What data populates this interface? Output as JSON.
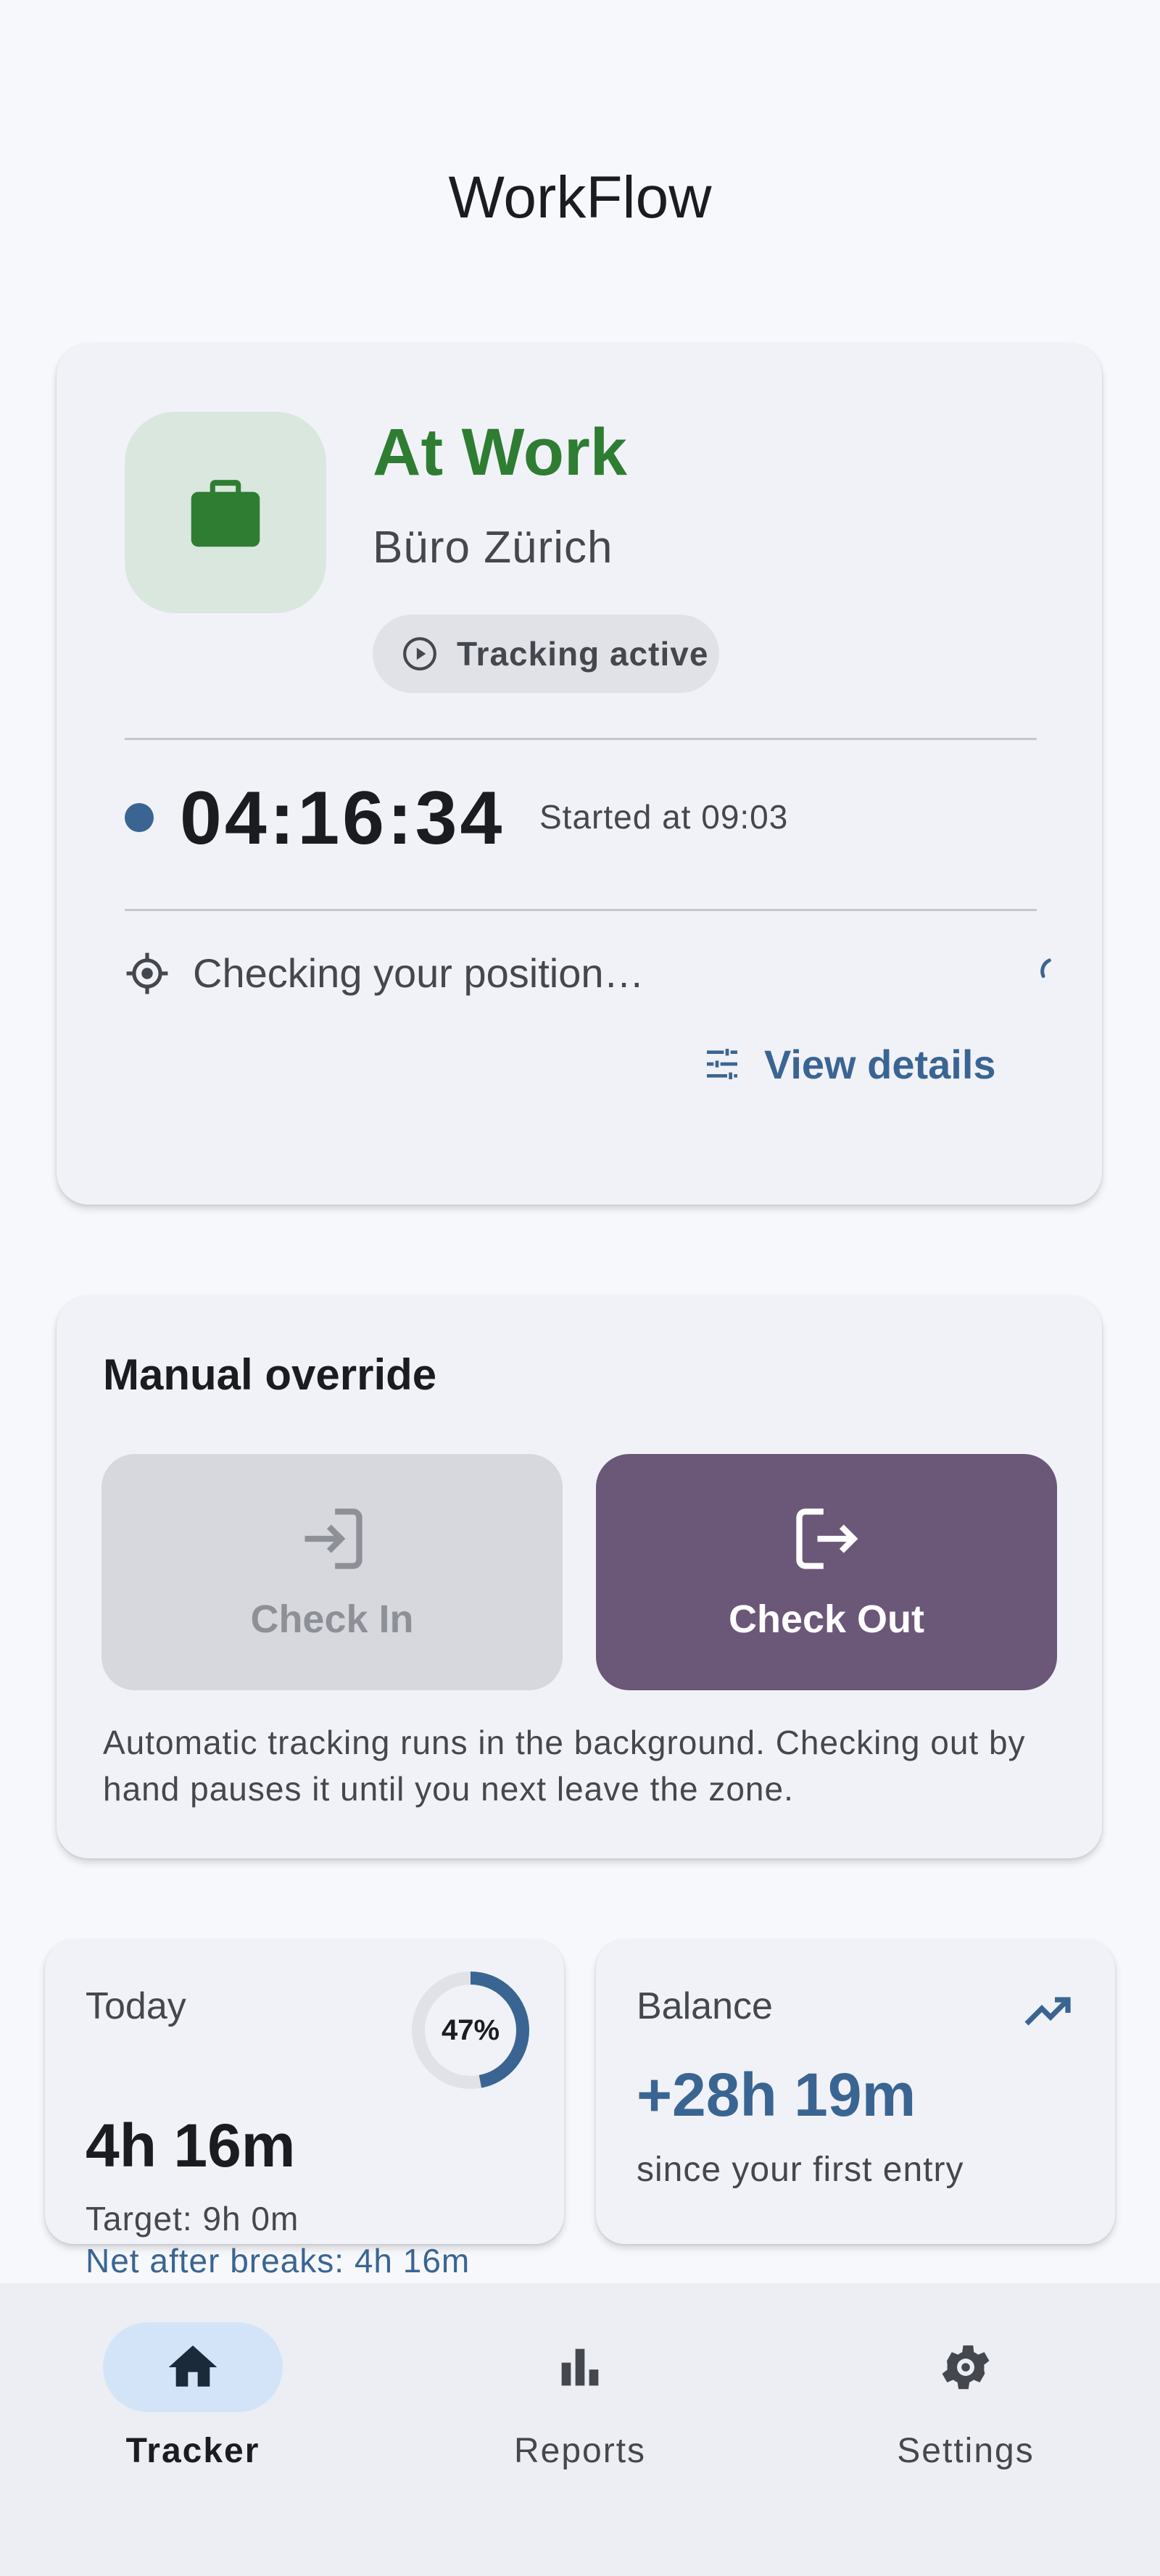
{
  "app": {
    "title": "WorkFlow"
  },
  "status": {
    "title": "At Work",
    "location": "Büro Zürich",
    "chip_label": "Tracking active",
    "timer": "04:16:34",
    "started": "Started at 09:03",
    "gps_text": "Checking your position…",
    "details_label": "View details",
    "colors": {
      "status": "#2e7d32",
      "accent": "#3a6592"
    }
  },
  "override": {
    "title": "Manual override",
    "check_in_label": "Check In",
    "check_out_label": "Check Out",
    "note": "Automatic tracking runs in the background. Checking out by hand pauses it until you next leave the zone.",
    "colors": {
      "check_out_bg": "#6b5778",
      "check_in_bg": "#d7d8de"
    }
  },
  "today": {
    "label": "Today",
    "progress_label": "47%",
    "progress": 0.47,
    "value": "4h 16m",
    "target": "Target: 9h 0m",
    "net": "Net after breaks: 4h 16m"
  },
  "balance": {
    "label": "Balance",
    "value": "+28h 19m",
    "sub": "since your first entry"
  },
  "nav": {
    "items": [
      {
        "label": "Tracker",
        "icon": "home-icon",
        "active": true
      },
      {
        "label": "Reports",
        "icon": "bar-chart-icon",
        "active": false
      },
      {
        "label": "Settings",
        "icon": "gear-icon",
        "active": false
      }
    ]
  }
}
